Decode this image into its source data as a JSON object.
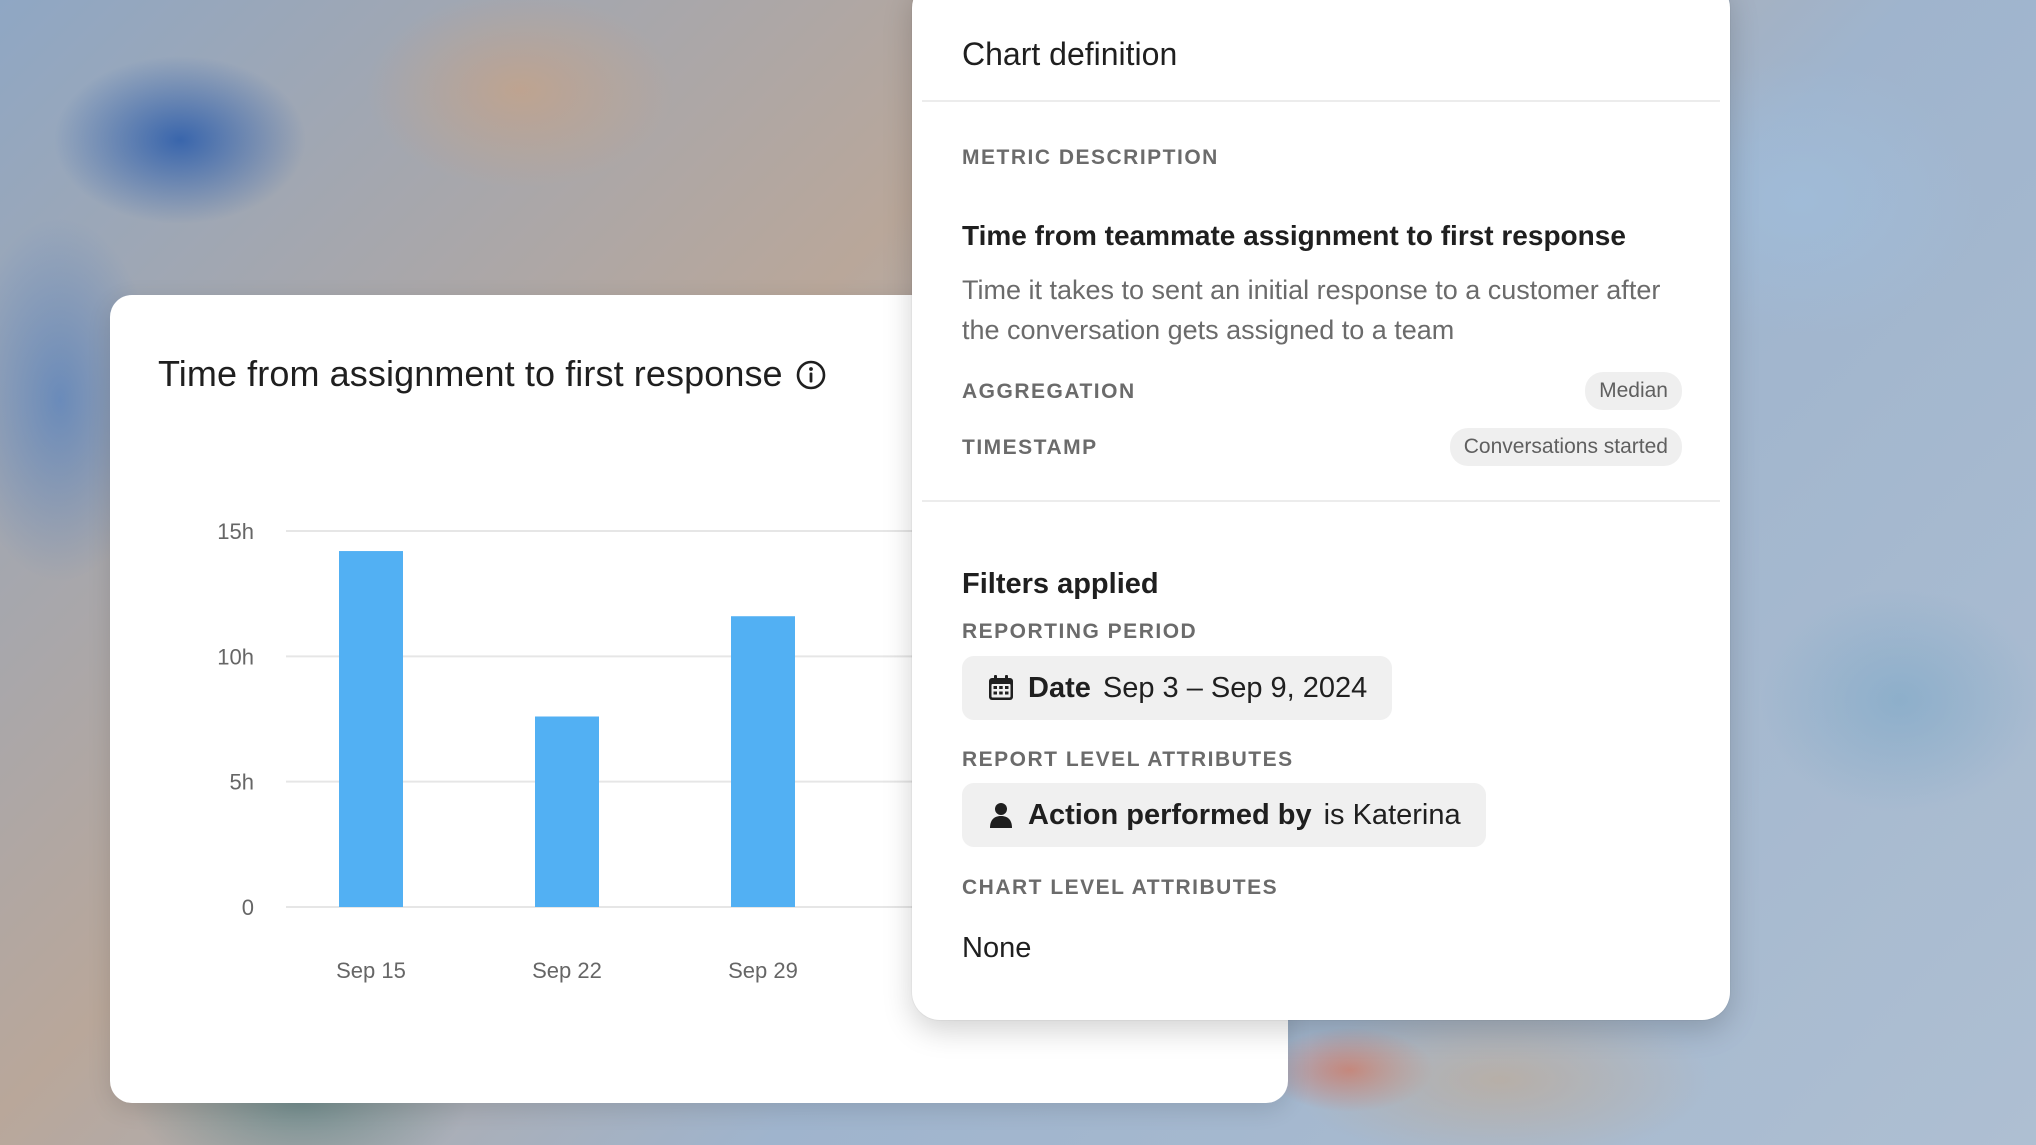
{
  "chart_card": {
    "title": "Time from assignment to first response"
  },
  "chart_data": {
    "type": "bar",
    "categories": [
      "Sep 15",
      "Sep 22",
      "Sep 29"
    ],
    "values": [
      14.2,
      7.6,
      11.6
    ],
    "yticks": [
      "0",
      "5h",
      "10h",
      "15h"
    ],
    "ylim": [
      0,
      15
    ],
    "grid": true,
    "bar_color": "#52b0f3"
  },
  "definition": {
    "title": "Chart definition",
    "metric_label": "METRIC DESCRIPTION",
    "metric_name": "Time from teammate assignment to first response",
    "metric_description": "Time it takes to sent an initial response to a customer after the conversation gets assigned to a team",
    "aggregation_label": "AGGREGATION",
    "aggregation_value": "Median",
    "timestamp_label": "TIMESTAMP",
    "timestamp_value": "Conversations started",
    "filters_title": "Filters applied",
    "reporting_label": "REPORTING PERIOD",
    "date_key": "Date",
    "date_value": "Sep 3 – Sep 9, 2024",
    "report_attr_label": "REPORT LEVEL ATTRIBUTES",
    "report_attr_key": "Action performed by",
    "report_attr_value": "is Katerina",
    "chart_attr_label": "CHART LEVEL ATTRIBUTES",
    "chart_attr_value": "None"
  },
  "icons": {
    "info": "info-icon",
    "calendar": "calendar-icon",
    "person": "person-icon"
  }
}
